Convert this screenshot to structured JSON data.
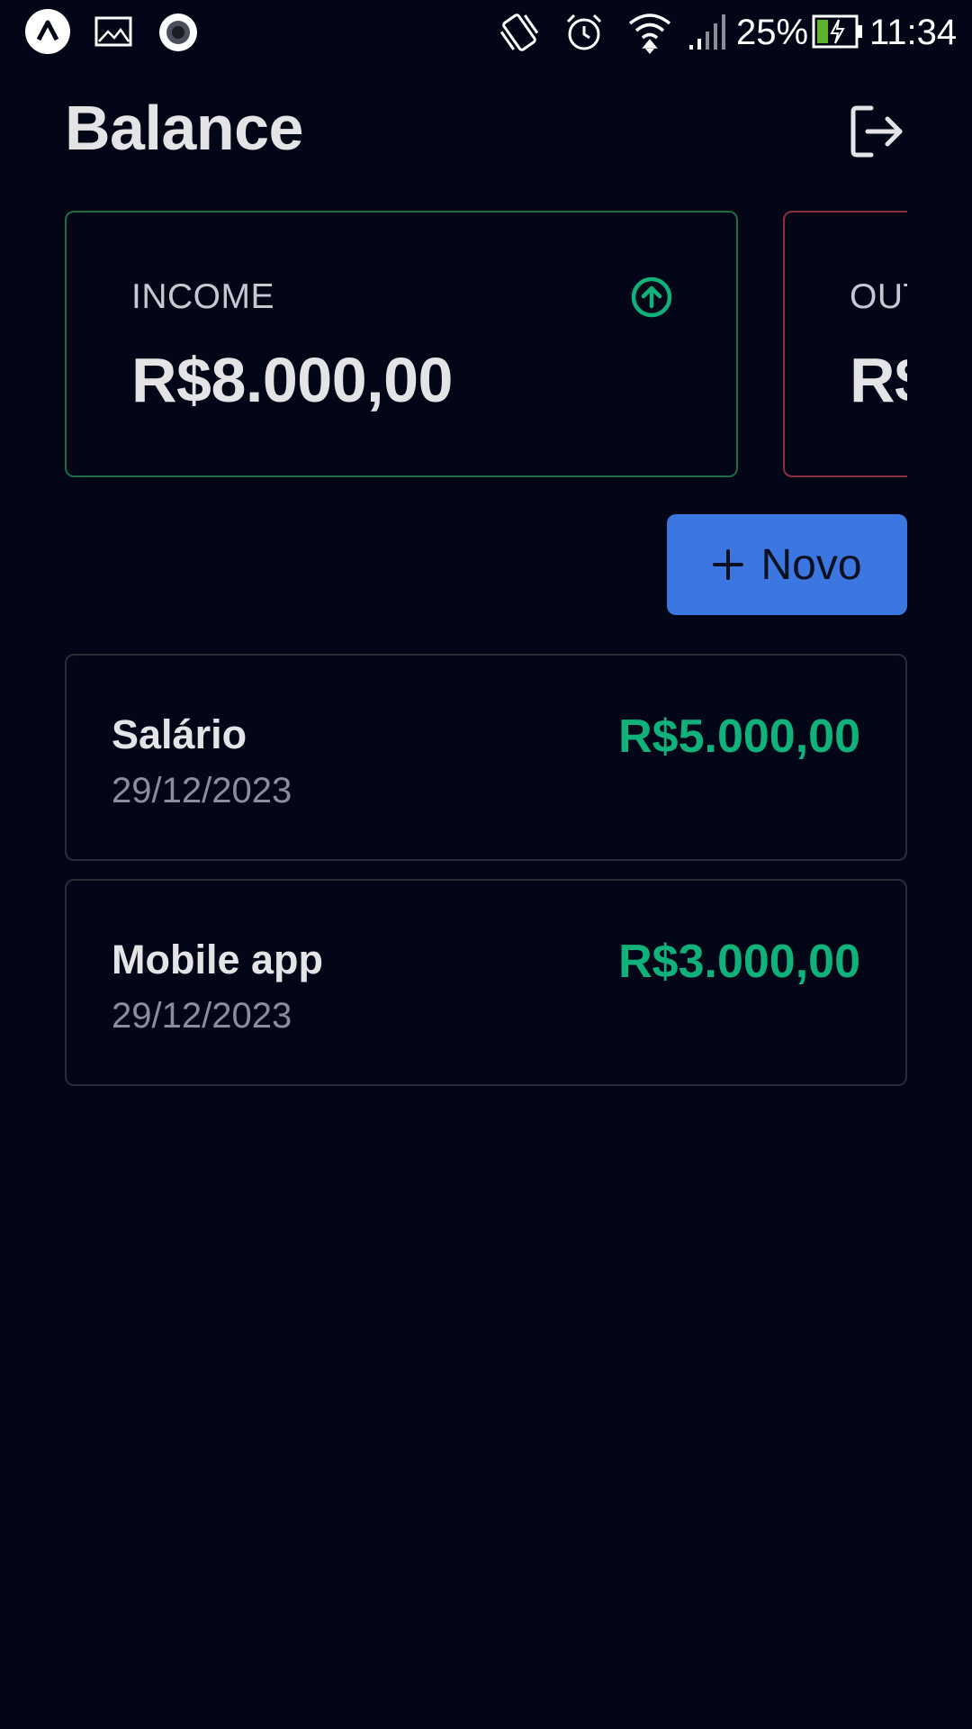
{
  "status_bar": {
    "icons": [
      "app-logo-icon",
      "gallery-icon",
      "record-icon",
      "vibrate-icon",
      "alarm-icon",
      "wifi-icon",
      "signal-icon",
      "battery-charging-icon"
    ],
    "battery_percent": "25%",
    "time": "11:34"
  },
  "header": {
    "title": "Balance",
    "logout_icon": "logout-icon"
  },
  "summary": {
    "income": {
      "label": "INCOME",
      "value": "R$8.000,00",
      "icon": "arrow-up-circle-icon",
      "color": "#10b17a"
    },
    "outcome": {
      "label": "OUT",
      "value": "R$",
      "color": "#8c2e3e"
    }
  },
  "actions": {
    "new_label": "Novo",
    "new_icon": "plus-icon",
    "button_color": "#3b76e1"
  },
  "transactions": [
    {
      "title": "Salário",
      "date": "29/12/2023",
      "amount": "R$5.000,00"
    },
    {
      "title": "Mobile app",
      "date": "29/12/2023",
      "amount": "R$3.000,00"
    }
  ]
}
